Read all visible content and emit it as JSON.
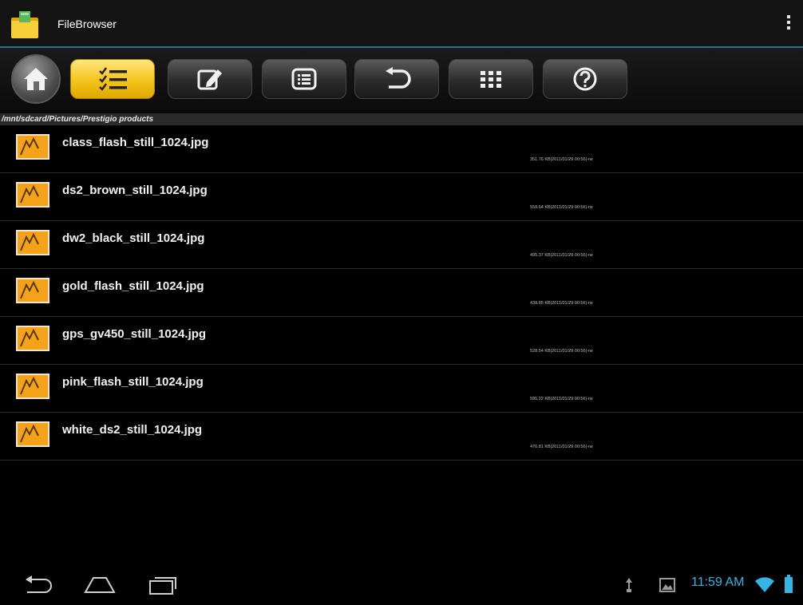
{
  "app": {
    "title": "FileBrowser",
    "icon": "filebrowser-folder-icon",
    "overflow_icon": "overflow-menu-icon"
  },
  "toolbar": {
    "buttons": [
      {
        "icon": "home-icon",
        "active": false
      },
      {
        "icon": "checklist-icon",
        "active": true
      },
      {
        "icon": "edit-icon",
        "active": false
      },
      {
        "icon": "list-view-icon",
        "active": false
      },
      {
        "icon": "undo-icon",
        "active": false
      },
      {
        "icon": "grid-view-icon",
        "active": false
      },
      {
        "icon": "help-icon",
        "active": false
      }
    ],
    "accent": "#f4c41a"
  },
  "path": "/mnt/sdcard/Pictures/Prestigio products",
  "files": [
    {
      "name": "class_flash_still_1024.jpg",
      "meta": "351.76 KB|2011/01/29 00:56|-rw"
    },
    {
      "name": "ds2_brown_still_1024.jpg",
      "meta": "558.64 KB|2011/01/29 00:56|-rw"
    },
    {
      "name": "dw2_black_still_1024.jpg",
      "meta": "495.37 KB|2011/01/29 00:56|-rw"
    },
    {
      "name": "gold_flash_still_1024.jpg",
      "meta": "438.85 KB|2011/01/29 00:56|-rw"
    },
    {
      "name": "gps_gv450_still_1024.jpg",
      "meta": "528.54 KB|2011/01/29 00:56|-rw"
    },
    {
      "name": "pink_flash_still_1024.jpg",
      "meta": "595.22 KB|2011/01/29 00:56|-rw"
    },
    {
      "name": "white_ds2_still_1024.jpg",
      "meta": "476.81 KB|2011/01/29 00:56|-rw"
    }
  ],
  "system_bar": {
    "time": "11:59 AM",
    "nav_icons": [
      "back-icon",
      "home-nav-icon",
      "recent-apps-icon"
    ],
    "status_icons": [
      "usb-icon",
      "gallery-notification-icon",
      "wifi-icon",
      "battery-icon"
    ],
    "accent": "#33b5e5"
  }
}
